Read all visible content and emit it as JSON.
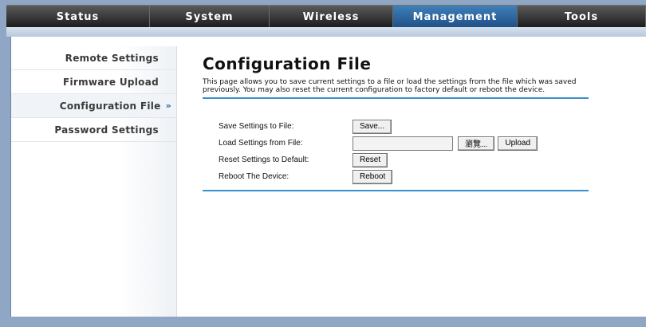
{
  "nav": {
    "tabs": [
      {
        "label": "Status",
        "active": false
      },
      {
        "label": "System",
        "active": false
      },
      {
        "label": "Wireless",
        "active": false
      },
      {
        "label": "Management",
        "active": true
      },
      {
        "label": "Tools",
        "active": false
      }
    ]
  },
  "sidebar": {
    "items": [
      {
        "label": "Remote Settings",
        "active": false
      },
      {
        "label": "Firmware Upload",
        "active": false
      },
      {
        "label": "Configuration File",
        "active": true
      },
      {
        "label": "Password Settings",
        "active": false
      }
    ],
    "active_arrow": "»"
  },
  "page": {
    "title": "Configuration File",
    "description": "This page allows you to save current settings to a file or load the settings from the file which was saved previously. You may also reset the current configuration to factory default or reboot the device."
  },
  "form": {
    "save": {
      "label": "Save Settings to File:",
      "button": "Save..."
    },
    "load": {
      "label": "Load Settings from File:",
      "file_value": "",
      "browse_button": "瀏覽...",
      "upload_button": "Upload"
    },
    "reset": {
      "label": "Reset Settings to Default:",
      "button": "Reset"
    },
    "reboot": {
      "label": "Reboot The Device:",
      "button": "Reboot"
    }
  },
  "colors": {
    "accent": "#3a8fce",
    "nav_active": "#2f6aa3",
    "background": "#8fa6c4"
  }
}
